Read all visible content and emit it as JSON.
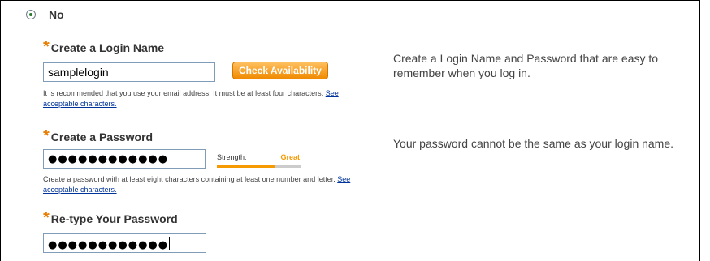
{
  "radio": {
    "label": "No",
    "selected": true
  },
  "login": {
    "label": "Create a Login Name",
    "value": "samplelogin",
    "check_button": "Check Availability",
    "hint": "It is recommended that you use your email address. It must be at least four characters.",
    "hint_link": "See acceptable characters.",
    "help": "Create a Login Name and Password that are easy to remember when you log in."
  },
  "password": {
    "label": "Create a Password",
    "value": "●●●●●●●●●●●●",
    "strength_label": "Strength:",
    "strength_value": "Great",
    "strength_fraction": 0.68,
    "hint": "Create a password with at least eight characters containing at least one number and letter.",
    "hint_link": "See acceptable characters.",
    "help": "Your password cannot be the same as your login name."
  },
  "retype": {
    "label": "Re-type Your Password",
    "value": "●●●●●●●●●●●●"
  },
  "colors": {
    "required_asterisk": "#e87e04",
    "check_button": "#f59a00",
    "strength_fill": "#f59a00",
    "link": "#003399"
  }
}
